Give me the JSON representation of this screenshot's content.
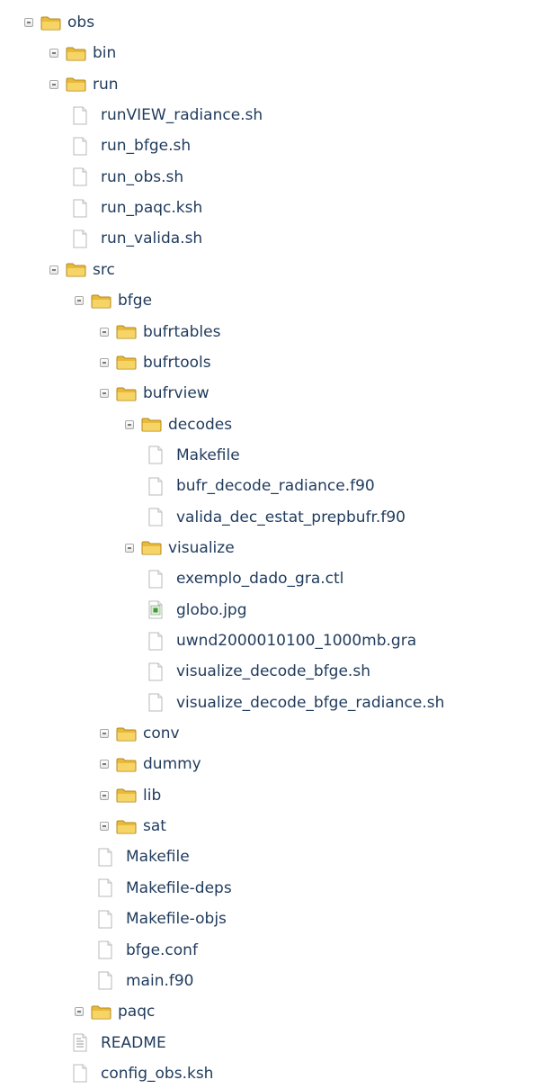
{
  "tree": [
    {
      "label": "obs",
      "type": "folder",
      "depth": 0,
      "expanded": true
    },
    {
      "label": "bin",
      "type": "folder",
      "depth": 1
    },
    {
      "label": "run",
      "type": "folder",
      "depth": 1,
      "expanded": true
    },
    {
      "label": "runVIEW_radiance.sh",
      "type": "file",
      "depth": 2
    },
    {
      "label": "run_bfge.sh",
      "type": "file",
      "depth": 2
    },
    {
      "label": "run_obs.sh",
      "type": "file",
      "depth": 2
    },
    {
      "label": "run_paqc.ksh",
      "type": "file",
      "depth": 2
    },
    {
      "label": "run_valida.sh",
      "type": "file",
      "depth": 2
    },
    {
      "label": "src",
      "type": "folder",
      "depth": 1,
      "expanded": true
    },
    {
      "label": "bfge",
      "type": "folder",
      "depth": 2,
      "expanded": true
    },
    {
      "label": "bufrtables",
      "type": "folder",
      "depth": 3
    },
    {
      "label": "bufrtools",
      "type": "folder",
      "depth": 3
    },
    {
      "label": "bufrview",
      "type": "folder",
      "depth": 3,
      "expanded": true
    },
    {
      "label": "decodes",
      "type": "folder",
      "depth": 4,
      "expanded": true
    },
    {
      "label": "Makefile",
      "type": "file",
      "depth": 5
    },
    {
      "label": "bufr_decode_radiance.f90",
      "type": "file",
      "depth": 5
    },
    {
      "label": "valida_dec_estat_prepbufr.f90",
      "type": "file",
      "depth": 5
    },
    {
      "label": "visualize",
      "type": "folder",
      "depth": 4,
      "expanded": true
    },
    {
      "label": "exemplo_dado_gra.ctl",
      "type": "file",
      "depth": 5
    },
    {
      "label": "globo.jpg",
      "type": "image",
      "depth": 5
    },
    {
      "label": "uwnd2000010100_1000mb.gra",
      "type": "file",
      "depth": 5
    },
    {
      "label": "visualize_decode_bfge.sh",
      "type": "file",
      "depth": 5
    },
    {
      "label": "visualize_decode_bfge_radiance.sh",
      "type": "file",
      "depth": 5
    },
    {
      "label": "conv",
      "type": "folder",
      "depth": 3
    },
    {
      "label": "dummy",
      "type": "folder",
      "depth": 3
    },
    {
      "label": "lib",
      "type": "folder",
      "depth": 3
    },
    {
      "label": "sat",
      "type": "folder",
      "depth": 3
    },
    {
      "label": "Makefile",
      "type": "file",
      "depth": 3
    },
    {
      "label": "Makefile-deps",
      "type": "file",
      "depth": 3
    },
    {
      "label": "Makefile-objs",
      "type": "file",
      "depth": 3
    },
    {
      "label": "bfge.conf",
      "type": "file",
      "depth": 3
    },
    {
      "label": "main.f90",
      "type": "file",
      "depth": 3
    },
    {
      "label": "paqc",
      "type": "folder",
      "depth": 2
    },
    {
      "label": "README",
      "type": "text",
      "depth": 2
    },
    {
      "label": "config_obs.ksh",
      "type": "file",
      "depth": 2
    }
  ],
  "icons": {
    "folder": "folder-icon",
    "file": "file-icon",
    "text": "text-file-icon",
    "image": "image-file-icon",
    "toggle": "toggle-icon"
  },
  "colors": {
    "label": "#1f3a5c",
    "folder_fill": "#f2cd5a",
    "folder_stroke": "#c49a23",
    "file_stroke": "#b4b4b4"
  }
}
